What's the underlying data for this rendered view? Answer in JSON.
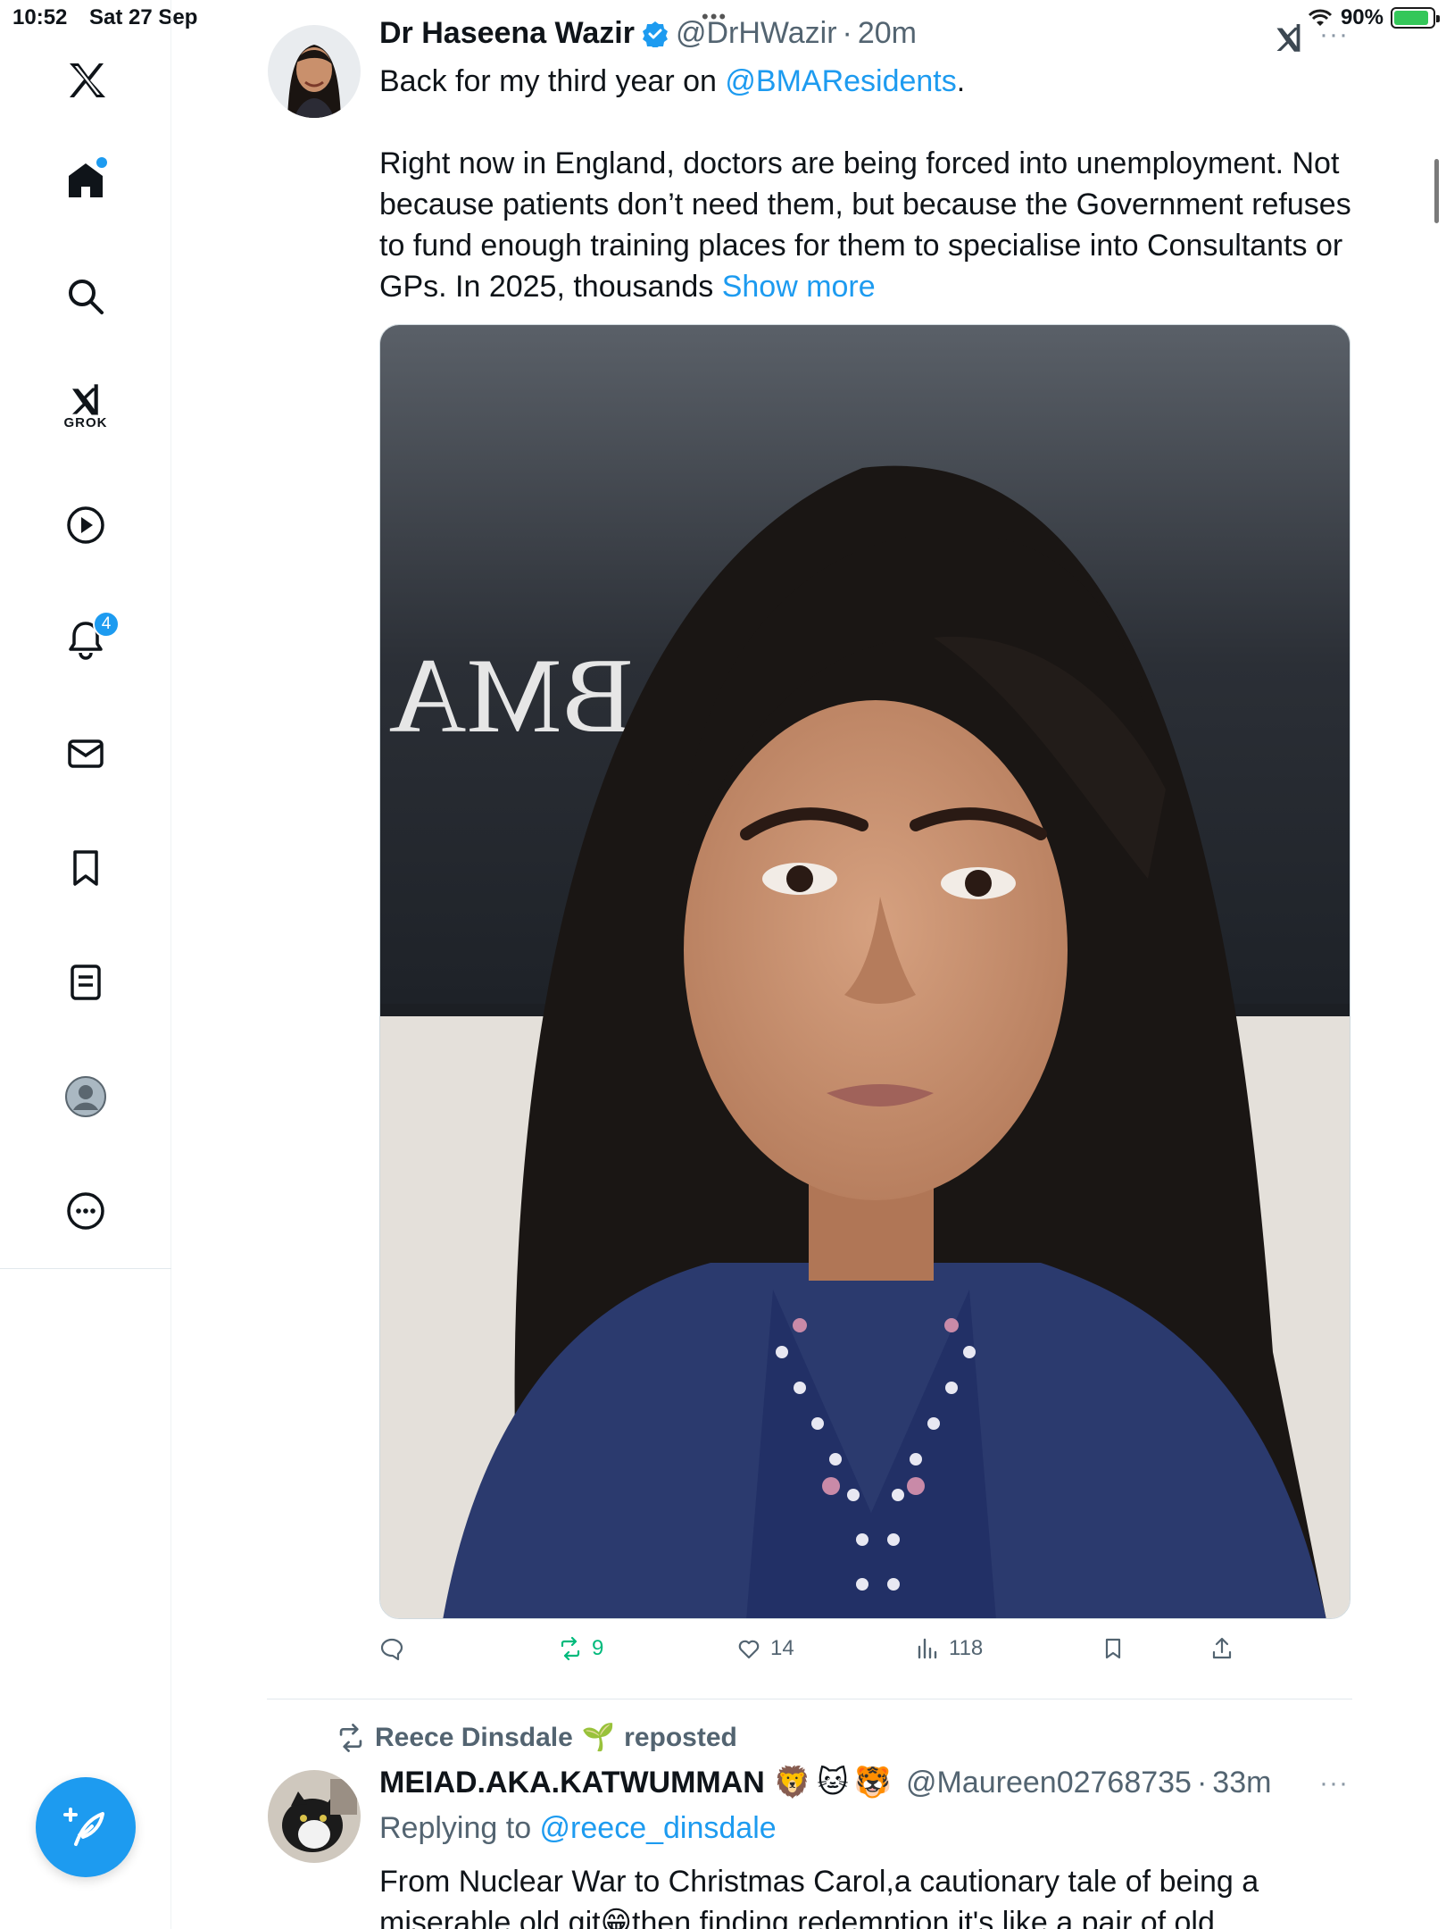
{
  "status_bar": {
    "time": "10:52",
    "date": "Sat 27 Sep",
    "battery_percent": "90%",
    "battery_level": 0.9,
    "dots": "•••"
  },
  "sidebar": {
    "items": [
      {
        "icon": "x-logo-icon"
      },
      {
        "icon": "home-icon",
        "has_dot": true
      },
      {
        "icon": "search-icon"
      },
      {
        "icon": "grok-icon",
        "label": "GROK"
      },
      {
        "icon": "video-icon"
      },
      {
        "icon": "bell-icon",
        "badge": "4"
      },
      {
        "icon": "mail-icon"
      },
      {
        "icon": "bookmark-icon"
      },
      {
        "icon": "list-icon"
      },
      {
        "icon": "profile-icon"
      },
      {
        "icon": "more-circle-icon"
      }
    ],
    "compose_icon": "compose-feather-icon"
  },
  "tweet": {
    "name": "Dr Haseena Wazir",
    "handle": "@DrHWazir",
    "separator": "·",
    "time": "20m",
    "more": "···",
    "line1_prefix": "Back for my third year on ",
    "line1_link": "@BMAResidents",
    "line1_suffix": ".",
    "body": "Right now in England, doctors are being forced into unemployment. Not because patients don’t need them, but because the Government refuses to fund enough training places for them to specialise into Consultants or GPs. In 2025, thousands ",
    "show_more": "Show more",
    "image_sign_text": "BMA",
    "stats": {
      "reply_icon": "reply-icon",
      "retweets": "9",
      "likes": "14",
      "views": "118",
      "bookmark_icon": "bookmark-icon",
      "share_icon": "share-icon"
    }
  },
  "next_tweet": {
    "reposted_by": "Reece Dinsdale",
    "reposted_emoji": "🌱",
    "reposted_label": "reposted",
    "name": "MEIAD.AKA.KATWUMMAN",
    "name_emojis": "🦁🐱🐯",
    "handle": "@Maureen02768735",
    "separator": "·",
    "time": "33m",
    "more": "···",
    "replying_to_label": "Replying to ",
    "replying_to_handle": "@reece_dinsdale",
    "line1": "From Nuclear War to Christmas Carol,a cautionary tale of being a",
    "line2": "miserable old git😁then finding redemption.it's like a pair of old"
  },
  "grok_top_icon": "grok-icon",
  "colors": {
    "accent": "#1d9bf0",
    "retweet_green": "#00ba7c",
    "secondary_text": "#536471"
  }
}
